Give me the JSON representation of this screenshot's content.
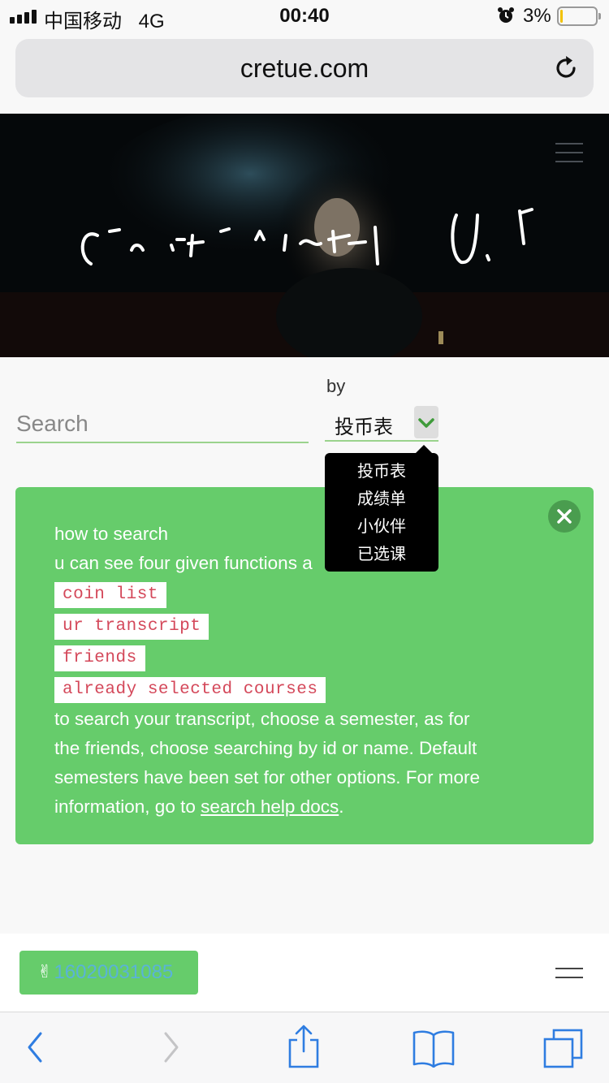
{
  "status_bar": {
    "carrier": "中国移动",
    "network": "4G",
    "time": "00:40",
    "battery_percent": "3%",
    "battery_level": 0.03,
    "icons": [
      "signal-icon",
      "alarm-icon",
      "battery-icon"
    ]
  },
  "browser": {
    "url": "cretue.com",
    "icons": [
      "reload-icon",
      "back-icon",
      "forward-icon",
      "share-icon",
      "bookmarks-icon",
      "tabs-icon"
    ]
  },
  "hero": {
    "icons": [
      "hamburger-menu-icon"
    ]
  },
  "search": {
    "placeholder": "Search",
    "by_label": "by",
    "selected_option": "投币表",
    "options": [
      "投币表",
      "成绩单",
      "小伙伴",
      "已选课"
    ]
  },
  "help": {
    "line1": "how to search",
    "line2": "u can see four given functions a",
    "chips": [
      "coin list",
      "ur transcript",
      "friends",
      "already selected courses"
    ],
    "para_lines": [
      "to search your transcript, choose a semester, as for",
      "the friends, choose searching by id or name. Default",
      "semesters have been set for other options. For more"
    ],
    "last_line_prefix": "information, go to ",
    "link_text": "search help docs",
    "last_line_suffix": "."
  },
  "footer": {
    "user_id": "16020031085"
  },
  "colors": {
    "accent_green": "#66cc6b",
    "chip_text": "#d4485a",
    "link_blue": "#2f7de1"
  }
}
